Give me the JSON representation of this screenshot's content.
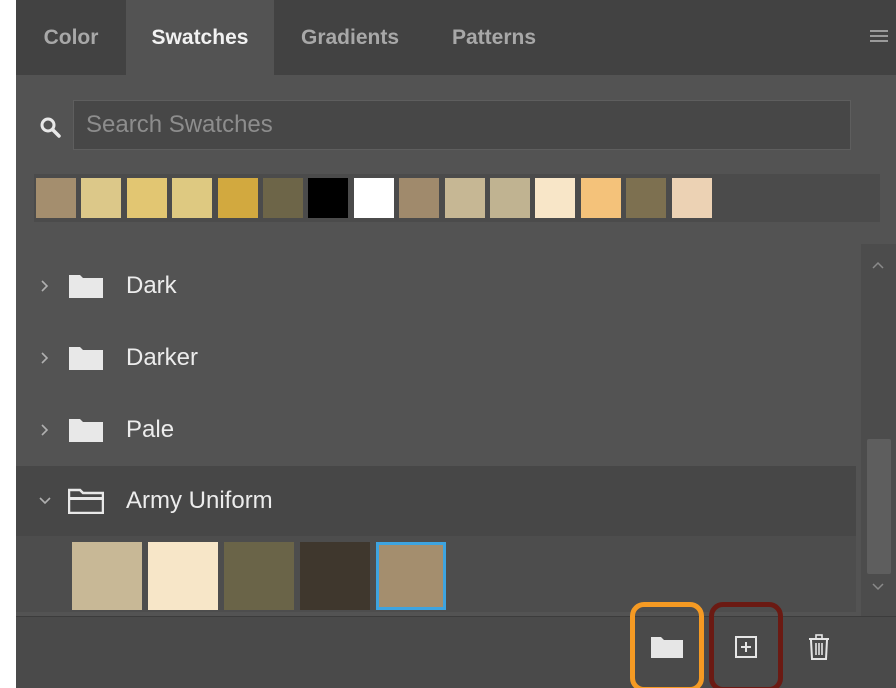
{
  "tabs": [
    {
      "label": "Color",
      "active": false
    },
    {
      "label": "Swatches",
      "active": true
    },
    {
      "label": "Gradients",
      "active": false
    },
    {
      "label": "Patterns",
      "active": false
    }
  ],
  "search": {
    "placeholder": "Search Swatches",
    "value": ""
  },
  "recent_swatches": [
    "#a48e6e",
    "#dcc889",
    "#e2c672",
    "#dec981",
    "#d2a93f",
    "#6d6548",
    "#000000",
    "#ffffff",
    "#a08a6c",
    "#c6b794",
    "#c0b391",
    "#f8e6c8",
    "#f4c27a",
    "#7d7050",
    "#ecd2b4"
  ],
  "groups": [
    {
      "label": "Dark",
      "expanded": false
    },
    {
      "label": "Darker",
      "expanded": false
    },
    {
      "label": "Pale",
      "expanded": false
    },
    {
      "label": "Army Uniform",
      "expanded": true
    }
  ],
  "army_uniform_swatches": [
    {
      "color": "#c8b896",
      "selected": false
    },
    {
      "color": "#f7e6c8",
      "selected": false
    },
    {
      "color": "#6a6448",
      "selected": false
    },
    {
      "color": "#3f372d",
      "selected": false
    },
    {
      "color": "#a48e6e",
      "selected": true
    }
  ],
  "icons": {
    "search": "search-icon",
    "panel_menu": "menu-icon",
    "new_group": "folder-icon",
    "new_swatch": "plus-square-icon",
    "delete": "trash-icon"
  },
  "highlight_colors": {
    "new_group": "#f59a23",
    "new_swatch": "#6b1a13"
  }
}
